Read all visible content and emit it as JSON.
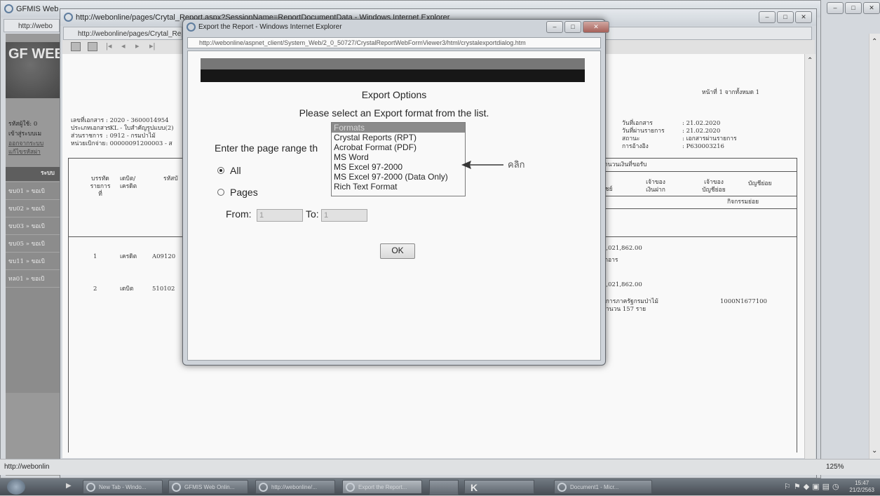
{
  "outer_window": {
    "title": "GFMIS Web",
    "address": "http://webo"
  },
  "mid_window": {
    "title": "http://webonline/pages/Crytal_Report.aspx?SessionName=ReportDocumentData - Windows Internet Explorer",
    "address": "http://webonline/pages/Crytal_Repor"
  },
  "dialog": {
    "title": "Export the Report - Windows Internet Explorer",
    "address": "http://webonline/aspnet_client/System_Web/2_0_50727/CrystalReportWebFormViewer3/html/crystalexportdialog.htm",
    "heading": "Export Options",
    "instruction": "Please select an Export format from the list.",
    "range_label": "Enter the page range th",
    "radio_all": "All",
    "radio_pages": "Pages",
    "from_label": "From:",
    "from_value": "1",
    "to_label": "To:",
    "to_value": "1",
    "ok_label": "OK",
    "formats": [
      "Formats",
      "Crystal Reports (RPT)",
      "Acrobat Format (PDF)",
      "MS Word",
      "MS Excel 97-2000",
      "MS Excel 97-2000 (Data Only)",
      "Rich Text Format"
    ],
    "selected_format_index": 0,
    "annotation_text": "คลิก"
  },
  "report": {
    "page_info": "หน้าที่  1  จากทั้งหมด  1",
    "left_meta": [
      [
        "เลขที่เอกสาร",
        ": 2020 - 3600014954"
      ],
      [
        "ประเภทเอกสาร",
        ": KL - ใบสำคัญรูปแบบ(2)"
      ],
      [
        "ส่วนราชการ",
        ": 0912 - กรมป่าไม้"
      ],
      [
        "หน่วยเบิกจ่าย",
        ": 00000091200003 - ส"
      ]
    ],
    "right_meta": [
      [
        "วันที่เอกสาร",
        ": 21.02.2020"
      ],
      [
        "วันที่ผ่านรายการ",
        ": 21.02.2020"
      ],
      [
        "สถานะ",
        ": เอกสารผ่านรายการ"
      ],
      [
        "การอ้างอิง",
        ": P630003216"
      ]
    ],
    "col_headers": [
      "บรรทัด รายการที่",
      "เดบิต/ เครดิต",
      "รหัสบั"
    ],
    "right_headers": [
      "จำนวนเงินที่ขอรับ",
      "นิชย์",
      "เจ้าของ เงินฝาก",
      "เจ้าของ บัญชีย่อย",
      "บัญชีย่อย",
      "กิจกรรมย่อย"
    ],
    "rows": [
      {
        "line": "1",
        "dc": "เครดิต",
        "code": "A09120",
        "amount": "1,021,862.00",
        "extra": "เกอาร"
      },
      {
        "line": "2",
        "dc": "เดบิต",
        "code": "510102",
        "amount": "1,021,862.00",
        "extra": "าการภาครัฐกรมป่าไม้",
        "extra2": "จำนวน 157 ราย",
        "ref": "1000N1677100"
      }
    ]
  },
  "left_site": {
    "logo": "GF WEB",
    "user_label": "รหัสผู้ใช้: 0",
    "login_label": "เข้าสู่ระบบเม",
    "link1": "ออกจากระบบ",
    "link2": "แก้ไขรหัสผ่า",
    "menu_header": "ระบบ",
    "menu_items": [
      "ขบ01 » ขอเบิ",
      "ขบ02 » ขอเบิ",
      "ขบ03 » ขอเบิ",
      "ขบ05 » ขอเบิ",
      "ขบ11 » ขอเบิ",
      "ทล01 » ขอเบิ"
    ]
  },
  "status_bar": {
    "url": "http://webonlin",
    "zoom": "125%"
  },
  "taskbar": {
    "items": [
      "New Tab - Windo...",
      "GFMIS Web Onlin...",
      "http://webonline/...",
      "Export the Report...",
      "",
      "",
      "Document1 - Micr..."
    ],
    "clock_time": "15:47",
    "clock_date": "21/2/2563"
  }
}
